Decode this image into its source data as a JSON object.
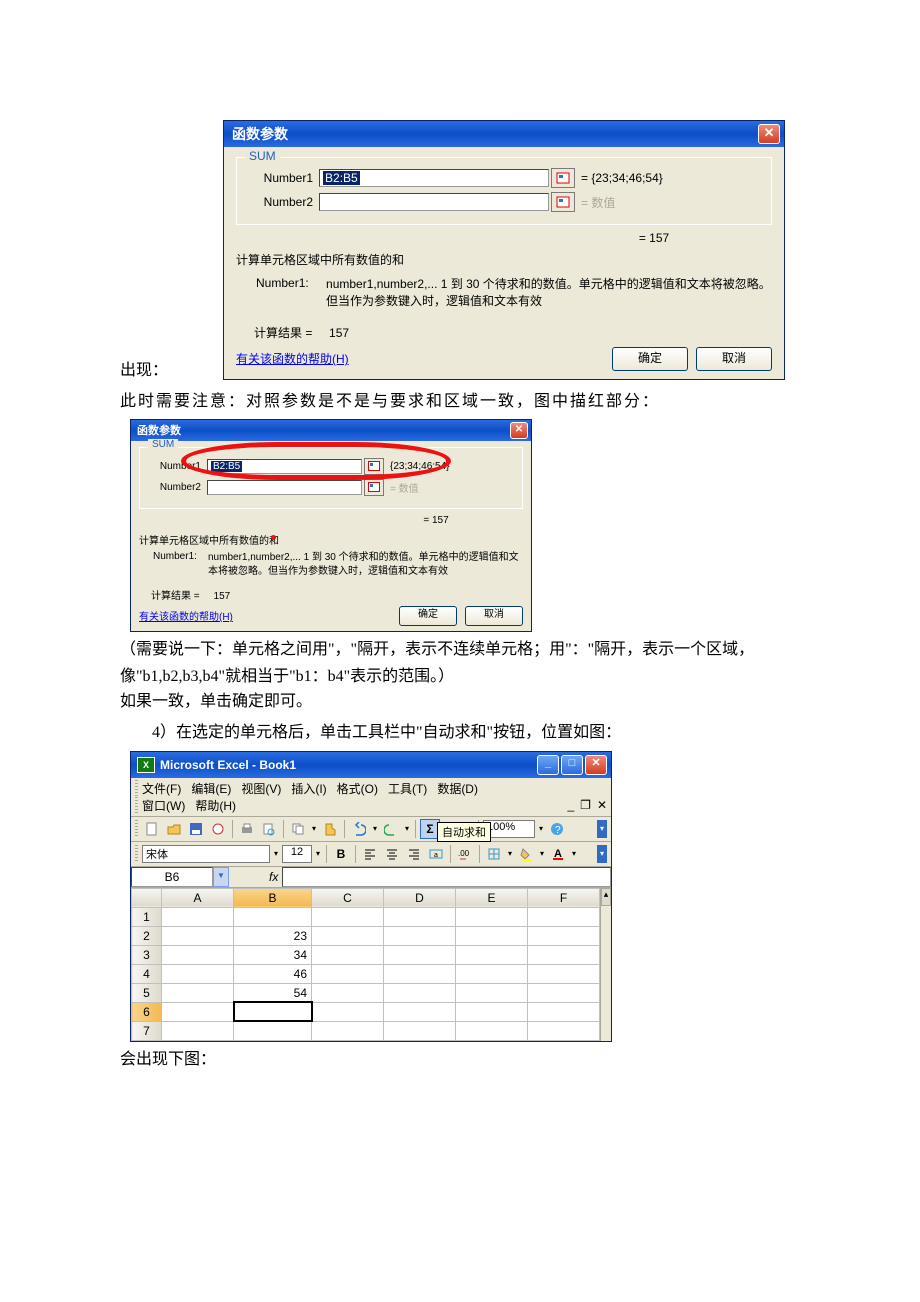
{
  "prefix_label": "出现：",
  "dialog1": {
    "title": "函数参数",
    "group": "SUM",
    "rows": [
      {
        "label": "Number1",
        "value": "B2:B5",
        "selected": true,
        "eq": "= {23;34;46;54}"
      },
      {
        "label": "Number2",
        "value": "",
        "selected": false,
        "eq": "= 数值",
        "faint": true
      }
    ],
    "result_eq": "= 157",
    "desc": "计算单元格区域中所有数值的和",
    "arg_name": "Number1:",
    "arg_desc": "number1,number2,... 1 到 30 个待求和的数值。单元格中的逻辑值和文本将被忽略。但当作为参数键入时，逻辑值和文本有效",
    "calc_label": "计算结果 =",
    "calc_value": "157",
    "help": "有关该函数的帮助(H)",
    "ok": "确定",
    "cancel": "取消"
  },
  "line_after_dialog1": "此时需要注意：对照参数是不是与要求和区域一致，图中描红部分：",
  "dialog2": {
    "title": "函数参数",
    "group": "SUM",
    "rows": [
      {
        "label": "Number1",
        "value": "B2:B5",
        "selected": true,
        "eq": "{23;34;46;54}"
      },
      {
        "label": "Number2",
        "value": "",
        "selected": false,
        "eq": "= 数值",
        "faint": true
      }
    ],
    "result_eq": "= 157",
    "desc": "计算单元格区域中所有数值的和",
    "arg_name": "Number1:",
    "arg_desc": "number1,number2,... 1 到 30 个待求和的数值。单元格中的逻辑值和文本将被忽略。但当作为参数键入时，逻辑值和文本有效",
    "calc_label": "计算结果 =",
    "calc_value": "157",
    "help": "有关该函数的帮助(H)",
    "ok": "确定",
    "cancel": "取消"
  },
  "para1": "（需要说一下：单元格之间用\"，\"隔开，表示不连续单元格；用\"：\"隔开，表示一个区域，像\"b1,b2,b3,b4\"就相当于\"b1：b4\"表示的范围。）",
  "para2": "如果一致，单击确定即可。",
  "para3": "　　4）在选定的单元格后，单击工具栏中\"自动求和\"按钮，位置如图：",
  "excel": {
    "title": "Microsoft Excel - Book1",
    "icon_text": "X",
    "menus": [
      "文件(F)",
      "编辑(E)",
      "视图(V)",
      "插入(I)",
      "格式(O)",
      "工具(T)",
      "数据(D)",
      "窗口(W)",
      "帮助(H)"
    ],
    "zoom": "100%",
    "font_name": "宋体",
    "font_size": "12",
    "name_box": "B6",
    "tooltip": "自动求和",
    "columns": [
      "",
      "A",
      "B",
      "C",
      "D",
      "E",
      "F"
    ],
    "rows": [
      {
        "n": "1",
        "b": ""
      },
      {
        "n": "2",
        "b": "23"
      },
      {
        "n": "3",
        "b": "34"
      },
      {
        "n": "4",
        "b": "46"
      },
      {
        "n": "5",
        "b": "54"
      },
      {
        "n": "6",
        "b": "",
        "active": true
      },
      {
        "n": "7",
        "b": ""
      }
    ]
  },
  "final_line": "会出现下图："
}
